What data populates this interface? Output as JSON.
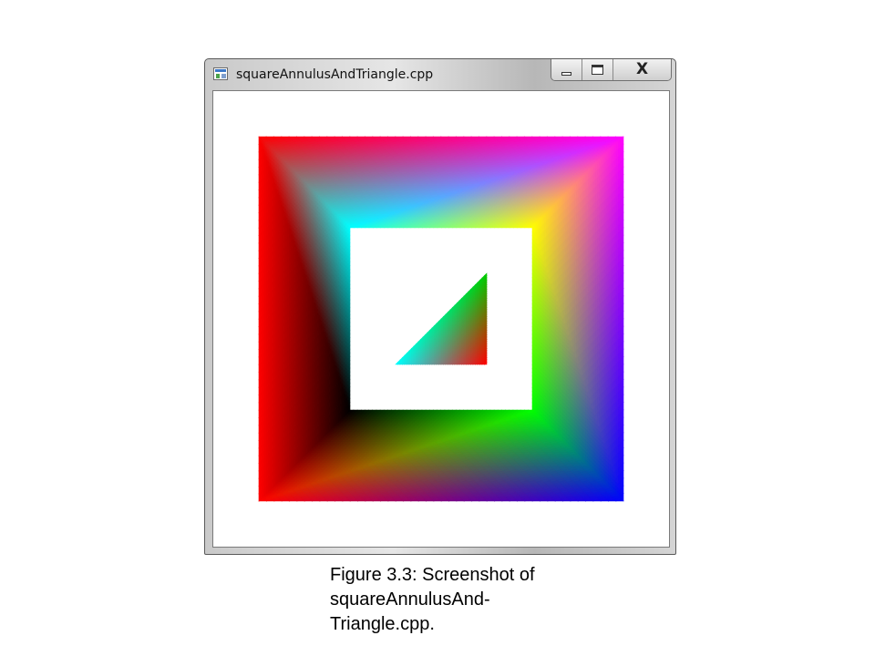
{
  "window": {
    "title": "squareAnnulusAndTriangle.cpp",
    "icon": "app-window-icon",
    "controls": [
      {
        "name": "minimize",
        "icon": "minimize-icon"
      },
      {
        "name": "maximize",
        "icon": "maximize-icon"
      },
      {
        "name": "close",
        "icon": "close-icon",
        "glyph": "X"
      }
    ]
  },
  "scene": {
    "background": "#ffffff",
    "annulus_outer_colors": [
      "#ff0000",
      "#ff00ff",
      "#0000ff",
      "#ff0000"
    ],
    "annulus_inner_colors": [
      "#00ffff",
      "#ffff00",
      "#00ff00",
      "#000000"
    ],
    "triangle_colors": [
      "#00ffff",
      "#00cc00",
      "#ff0000"
    ]
  },
  "caption": {
    "line1": "Figure 3.3: Screenshot of",
    "line2": "squareAnnulusAnd-",
    "line3": "Triangle.cpp."
  }
}
